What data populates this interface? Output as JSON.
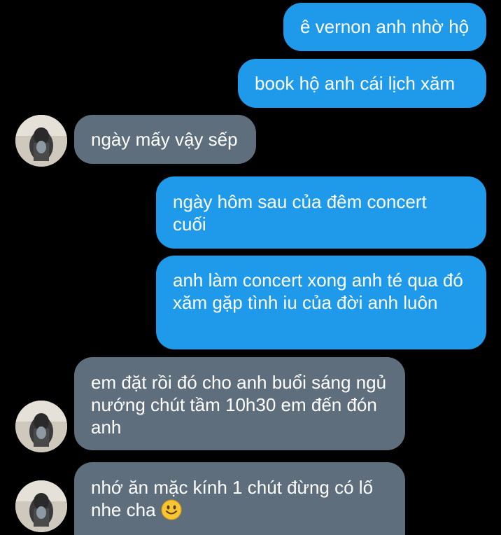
{
  "colors": {
    "background": "#000000",
    "outgoing_bubble": "#1f9aeb",
    "incoming_bubble": "#5e6e7d",
    "text": "#ffffff"
  },
  "messages": [
    {
      "direction": "outgoing",
      "text": "ê vernon anh nhờ hộ"
    },
    {
      "direction": "outgoing",
      "text": "book hộ anh cái lịch xăm"
    },
    {
      "direction": "incoming",
      "text": "ngày mấy vậy sếp"
    },
    {
      "direction": "outgoing",
      "text": "ngày hôm sau của đêm concert cuối"
    },
    {
      "direction": "outgoing",
      "text": "anh làm concert xong anh té qua đó xăm gặp tình iu của đời anh luôn"
    },
    {
      "direction": "incoming",
      "text": "em đặt rồi đó cho anh buổi sáng ngủ nướng chút tầm 10h30 em đến đón anh"
    },
    {
      "direction": "incoming",
      "text": "nhớ ăn mặc kính 1 chút đừng có lố nhe cha",
      "emoji": "smiling-face-emoji"
    }
  ]
}
